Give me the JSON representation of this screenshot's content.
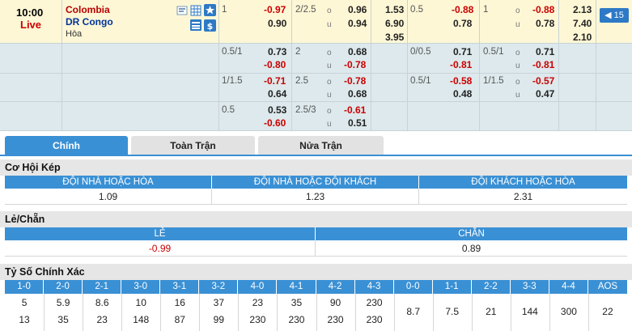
{
  "match": {
    "time": "10:00",
    "status": "Live",
    "home": "Colombia",
    "away": "DR Congo",
    "draw": "Hòa",
    "more_count": "15"
  },
  "odds_rows": [
    {
      "ft_hdp": "1",
      "ft_hdp_home": "-0.97",
      "ft_hdp_away": "0.90",
      "ft_ou": "2/2.5",
      "ft_ou_over": "0.96",
      "ft_ou_under": "0.94",
      "ft_1x2_1": "1.53",
      "ft_1x2_2": "6.90",
      "ft_1x2_x": "3.95",
      "h1_hdp": "0.5",
      "h1_hdp_home": "-0.88",
      "h1_hdp_away": "0.78",
      "h1_ou": "1",
      "h1_ou_over": "-0.88",
      "h1_ou_under": "0.78",
      "h1_1x2_1": "2.13",
      "h1_1x2_2": "7.40",
      "h1_1x2_x": "2.10"
    },
    {
      "ft_hdp": "0.5/1",
      "ft_hdp_home": "0.73",
      "ft_hdp_away": "-0.80",
      "ft_ou": "2",
      "ft_ou_over": "0.68",
      "ft_ou_under": "-0.78",
      "h1_hdp": "0/0.5",
      "h1_hdp_home": "0.71",
      "h1_hdp_away": "-0.81",
      "h1_ou": "0.5/1",
      "h1_ou_over": "0.71",
      "h1_ou_under": "-0.81"
    },
    {
      "ft_hdp": "1/1.5",
      "ft_hdp_home": "-0.71",
      "ft_hdp_away": "0.64",
      "ft_ou": "2.5",
      "ft_ou_over": "-0.78",
      "ft_ou_under": "0.68",
      "h1_hdp": "0.5/1",
      "h1_hdp_home": "-0.58",
      "h1_hdp_away": "0.48",
      "h1_ou": "1/1.5",
      "h1_ou_over": "-0.57",
      "h1_ou_under": "0.47"
    },
    {
      "ft_hdp": "0.5",
      "ft_hdp_home": "0.53",
      "ft_hdp_away": "-0.60",
      "ft_ou": "2.5/3",
      "ft_ou_over": "-0.61",
      "ft_ou_under": "0.51"
    }
  ],
  "ou_labels": {
    "over": "o",
    "under": "u"
  },
  "tabs": [
    "Chính",
    "Toàn Trận",
    "Nửa Trận"
  ],
  "double_chance": {
    "title": "Cơ Hội Kép",
    "headers": [
      "ĐỘI NHÀ HOẶC HÒA",
      "ĐỘI NHÀ HOẶC ĐỘI KHÁCH",
      "ĐỘI KHÁCH HOẶC HÒA"
    ],
    "values": [
      "1.09",
      "1.23",
      "2.31"
    ]
  },
  "odd_even": {
    "title": "Lẻ/Chẵn",
    "headers": [
      "LẺ",
      "CHẴN"
    ],
    "values": [
      "-0.99",
      "0.89"
    ]
  },
  "correct_score": {
    "title": "Tỷ Số Chính Xác",
    "headers": [
      "1-0",
      "2-0",
      "2-1",
      "3-0",
      "3-1",
      "3-2",
      "4-0",
      "4-1",
      "4-2",
      "4-3",
      "0-0",
      "1-1",
      "2-2",
      "3-3",
      "4-4",
      "AOS"
    ],
    "home_row": [
      "5",
      "5.9",
      "8.6",
      "10",
      "16",
      "37",
      "23",
      "35",
      "90",
      "230"
    ],
    "away_row": [
      "13",
      "35",
      "23",
      "148",
      "87",
      "99",
      "230",
      "230",
      "230",
      "230"
    ],
    "draw_row": [
      "8.7",
      "7.5",
      "21",
      "144",
      "300",
      "22"
    ]
  },
  "colors": {
    "accent": "#3a90d4",
    "negative": "#cc0000",
    "match_row": "#fdf7d6",
    "alt_row": "#dde9ec"
  }
}
